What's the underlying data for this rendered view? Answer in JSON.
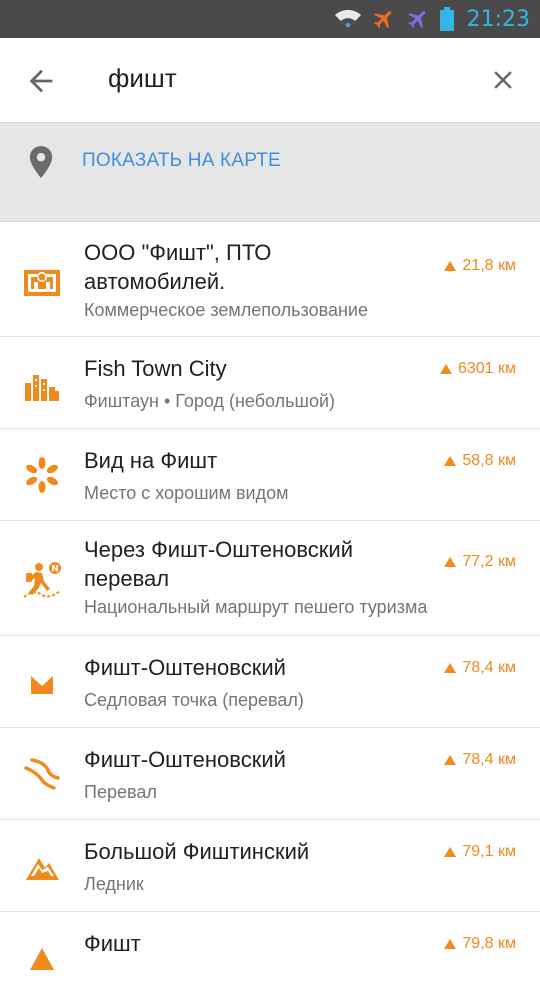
{
  "status_bar": {
    "time": "21:23"
  },
  "search": {
    "query": "фишт"
  },
  "show_on_map": {
    "label": "ПОКАЗАТЬ НА КАРТЕ"
  },
  "colors": {
    "accent": "#f08a1c",
    "link": "#3d8fde",
    "status_time": "#33b5e5"
  },
  "results": [
    {
      "icon": "industrial-site-icon",
      "title": "ООО \"Фишт\", ПТО автомобилей.",
      "subtitle": "Коммерческое землепользование",
      "distance": "21,8 км"
    },
    {
      "icon": "city-buildings-icon",
      "title": "Fish Town City",
      "subtitle": "Фиштаун • Город (небольшой)",
      "distance": "6301 км"
    },
    {
      "icon": "viewpoint-icon",
      "title": "Вид на Фишт",
      "subtitle": "Место с хорошим видом",
      "distance": "58,8 км"
    },
    {
      "icon": "hiking-route-icon",
      "title": "Через Фишт-Оштеновский перевал",
      "subtitle": "Национальный маршрут пешего туризма",
      "distance": "77,2 км"
    },
    {
      "icon": "saddle-icon",
      "title": "Фишт-Оштеновский",
      "subtitle": "Седловая точка (перевал)",
      "distance": "78,4 км"
    },
    {
      "icon": "mountain-pass-icon",
      "title": "Фишт-Оштеновский",
      "subtitle": "Перевал",
      "distance": "78,4 км"
    },
    {
      "icon": "glacier-icon",
      "title": "Большой Фиштинский",
      "subtitle": "Ледник",
      "distance": "79,1 км"
    },
    {
      "icon": "peak-icon",
      "title": "Фишт",
      "subtitle": "",
      "distance": "79,8 км"
    }
  ]
}
